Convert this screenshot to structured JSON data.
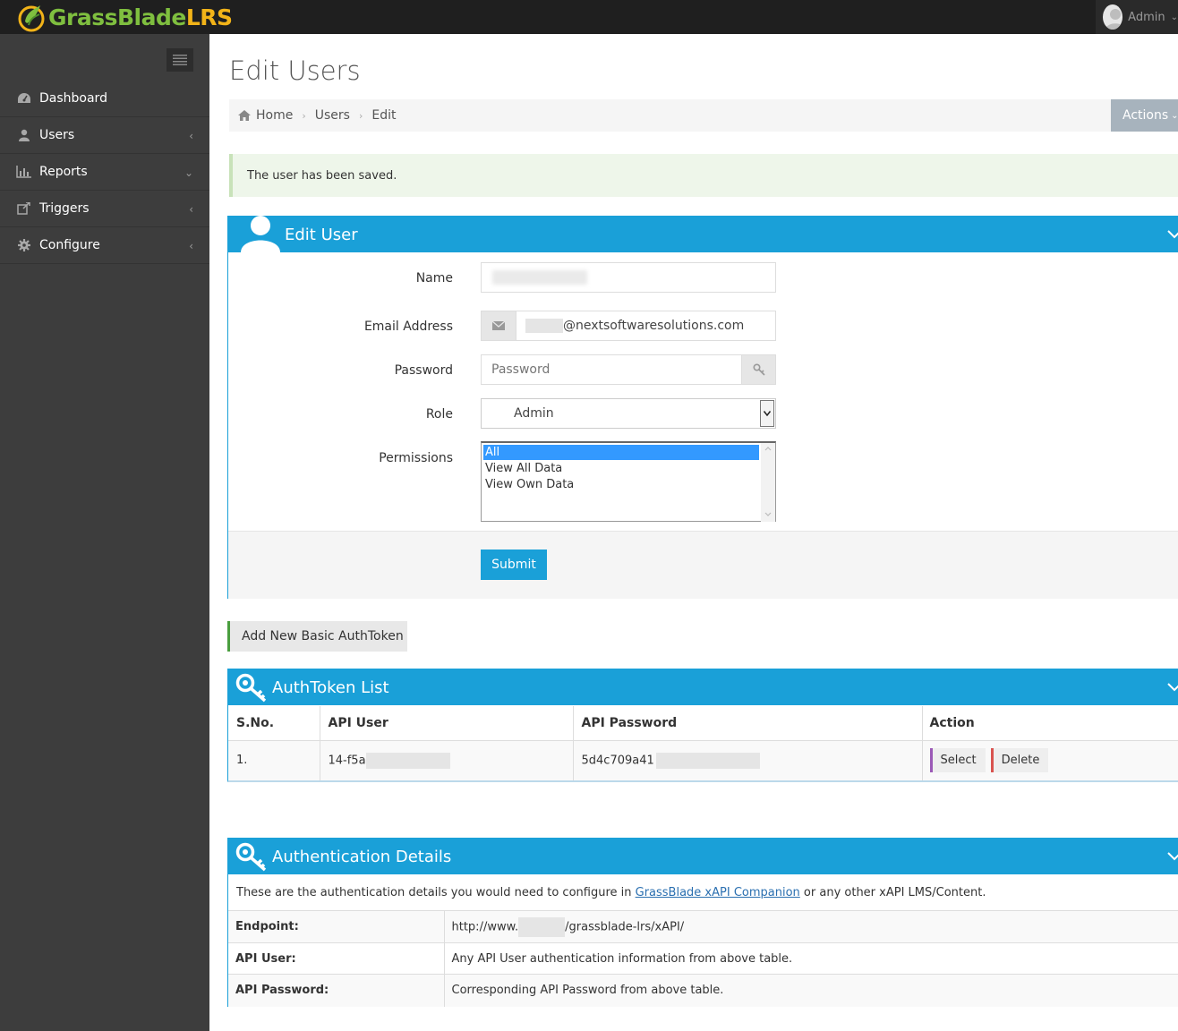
{
  "brand": {
    "part1": "GrassBlade",
    "part2": "LRS"
  },
  "user_menu": {
    "name": "Admin"
  },
  "sidebar": {
    "items": [
      {
        "label": "Dashboard",
        "icon": "dashboard-icon",
        "chevron": ""
      },
      {
        "label": "Users",
        "icon": "user-icon",
        "chevron": "left"
      },
      {
        "label": "Reports",
        "icon": "bar-chart-icon",
        "chevron": "down"
      },
      {
        "label": "Triggers",
        "icon": "external-link-icon",
        "chevron": "left"
      },
      {
        "label": "Configure",
        "icon": "gear-icon",
        "chevron": "left"
      }
    ]
  },
  "page": {
    "title": "Edit Users"
  },
  "breadcrumb": {
    "home": "Home",
    "users": "Users",
    "edit": "Edit"
  },
  "actions": {
    "label": "Actions"
  },
  "alert": {
    "message": "The user has been saved."
  },
  "edit_user": {
    "title": "Edit User",
    "name_label": "Name",
    "email_label": "Email Address",
    "email_domain": "@nextsoftwaresolutions.com",
    "password_label": "Password",
    "password_placeholder": "Password",
    "role_label": "Role",
    "role_value": "Admin",
    "permissions_label": "Permissions",
    "permissions": [
      "All",
      "View All Data",
      "View Own Data"
    ],
    "selected_permission": "All",
    "submit_label": "Submit"
  },
  "add_token": {
    "label": "Add New Basic AuthToken"
  },
  "token_list": {
    "title": "AuthToken List",
    "headers": [
      "S.No.",
      "API User",
      "API Password",
      "Action"
    ],
    "rows": [
      {
        "sno": "1.",
        "api_user": "14-f5a",
        "api_password": "5d4c709a41"
      }
    ],
    "select_label": "Select",
    "delete_label": "Delete"
  },
  "auth_details": {
    "title": "Authentication Details",
    "intro_before": "These are the authentication details you would need to configure in ",
    "intro_link": "GrassBlade xAPI Companion",
    "intro_after": " or any other xAPI LMS/Content.",
    "rows": [
      {
        "label": "Endpoint:",
        "value_prefix": "http://www.",
        "value_suffix": "/grassblade-lrs/xAPI/"
      },
      {
        "label": "API User:",
        "value": "Any API User authentication information from above table."
      },
      {
        "label": "API Password:",
        "value": "Corresponding API Password from above table."
      }
    ]
  },
  "colors": {
    "accent": "#1aa0d8",
    "sidebar": "#3d3d3d",
    "topbar": "#1f1f1f",
    "success_bg": "#eef6ea",
    "select_border": "#9b59b6",
    "delete_border": "#d9534f"
  }
}
